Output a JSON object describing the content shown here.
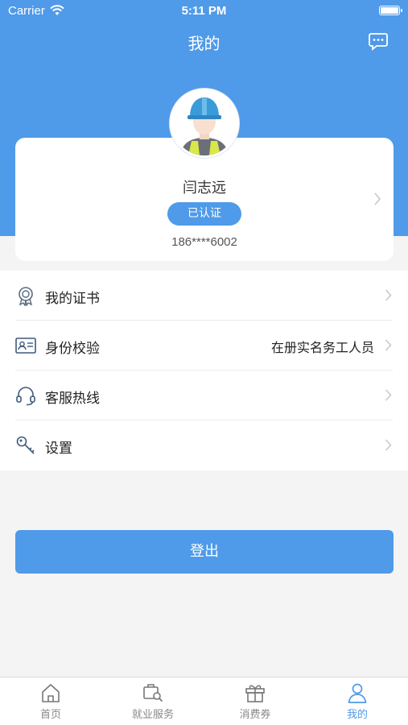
{
  "status_bar": {
    "carrier": "Carrier",
    "time": "5:11 PM"
  },
  "nav": {
    "title": "我的",
    "icon": "chat-icon"
  },
  "profile": {
    "name": "闫志远",
    "badge": "已认证",
    "phone": "186****6002",
    "avatar": "worker-avatar"
  },
  "menu": [
    {
      "label": "我的证书",
      "icon": "certificate-icon",
      "value": ""
    },
    {
      "label": "身份校验",
      "icon": "id-card-icon",
      "value": "在册实名务工人员"
    },
    {
      "label": "客服热线",
      "icon": "headset-icon",
      "value": ""
    },
    {
      "label": "设置",
      "icon": "key-icon",
      "value": ""
    }
  ],
  "logout_label": "登出",
  "tabs": [
    {
      "label": "首页",
      "icon": "home-icon",
      "active": false
    },
    {
      "label": "就业服务",
      "icon": "job-search-icon",
      "active": false
    },
    {
      "label": "消费券",
      "icon": "gift-icon",
      "active": false
    },
    {
      "label": "我的",
      "icon": "person-icon",
      "active": true
    }
  ],
  "colors": {
    "primary": "#4f9ae9",
    "background": "#f4f4f4"
  }
}
